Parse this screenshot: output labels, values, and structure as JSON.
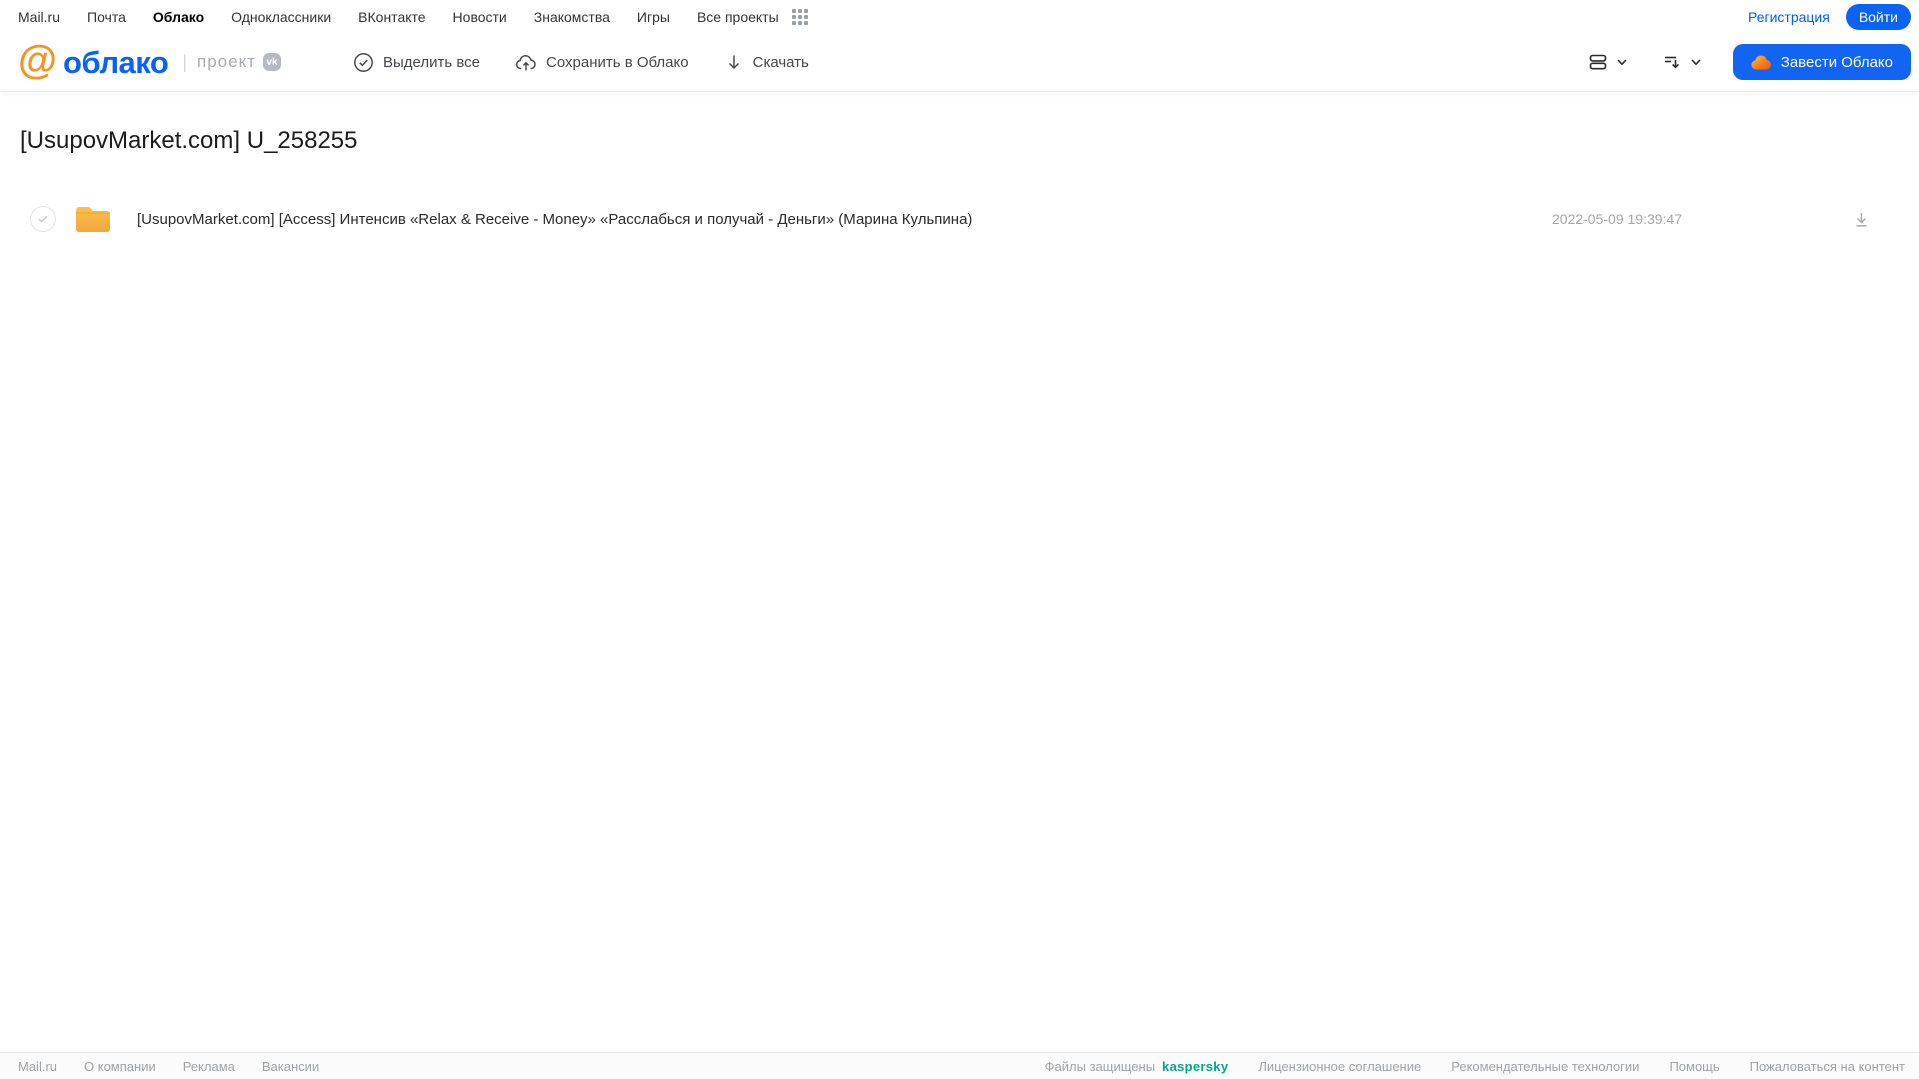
{
  "top_nav": {
    "items": [
      "Mail.ru",
      "Почта",
      "Облако",
      "Одноклассники",
      "ВКонтакте",
      "Новости",
      "Знакомства",
      "Игры",
      "Все проекты"
    ],
    "registration_label": "Регистрация",
    "login_label": "Войти"
  },
  "header": {
    "logo_at": "@",
    "logo_text": "облако",
    "project_label": "проект",
    "vk_badge": "vk",
    "select_all_label": "Выделить все",
    "save_to_cloud_label": "Сохранить в Облако",
    "download_label": "Скачать",
    "get_cloud_label": "Завести Облако"
  },
  "main": {
    "title": "[UsupovMarket.com] U_258255",
    "files": [
      {
        "name": "[UsupovMarket.com] [Access] Интенсив «Relax & Receive - Money» «Расслабься и получай - Деньги» (Марина Кульпина)",
        "date": "2022-05-09 19:39:47",
        "type": "folder"
      }
    ]
  },
  "footer": {
    "left_links": [
      "Mail.ru",
      "О компании",
      "Реклама",
      "Вакансии"
    ],
    "protected_label": "Файлы защищены",
    "kaspersky_label": "kaspersky",
    "right_links": [
      "Лицензионное соглашение",
      "Рекомендательные технологии",
      "Помощь",
      "Пожаловаться на контент"
    ]
  },
  "colors": {
    "accent_blue": "#1264f2",
    "logo_blue": "#0861fb",
    "brand_orange": "#f7941e",
    "folder_yellow": "#f9b53a",
    "kaspersky_green": "#00a88e"
  }
}
